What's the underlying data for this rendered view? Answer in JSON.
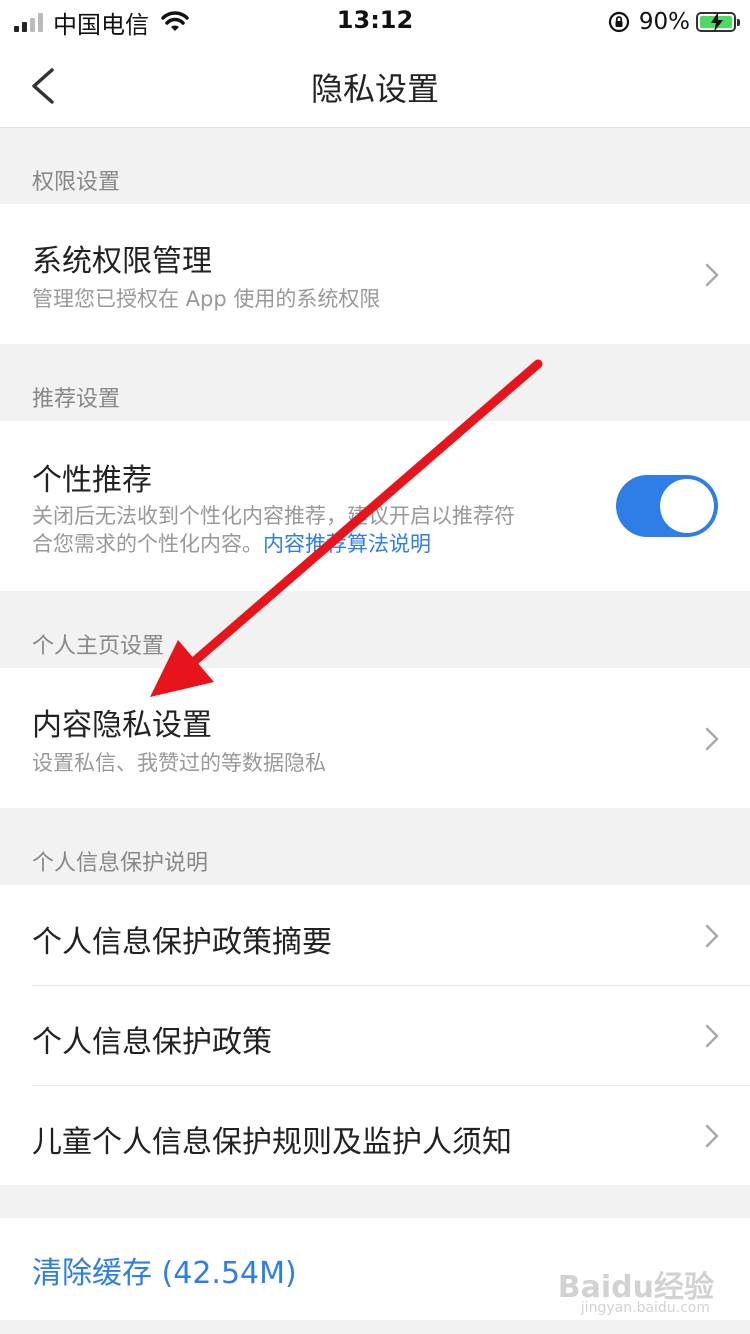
{
  "status_bar": {
    "carrier": "中国电信",
    "time": "13:12",
    "battery_percent": "90%",
    "icons": [
      "signal-icon",
      "wifi-icon",
      "orientation-lock-icon",
      "battery-charging-icon"
    ]
  },
  "nav": {
    "title": "隐私设置",
    "back_icon": "chevron-left-icon"
  },
  "sections": {
    "permissions": {
      "header": "权限设置",
      "items": [
        {
          "title": "系统权限管理",
          "subtitle": "管理您已授权在 App 使用的系统权限"
        }
      ]
    },
    "recommend": {
      "header": "推荐设置",
      "item": {
        "title": "个性推荐",
        "subtitle_line1": "关闭后无法收到个性化内容推荐，建议开启以推荐符",
        "subtitle_line2": "合您需求的个性化内容。",
        "link": "内容推荐算法说明",
        "toggle_on": true
      }
    },
    "profile": {
      "header": "个人主页设置",
      "items": [
        {
          "title": "内容隐私设置",
          "subtitle": "设置私信、我赞过的等数据隐私"
        }
      ]
    },
    "protection": {
      "header": "个人信息保护说明",
      "items": [
        {
          "title": "个人信息保护政策摘要"
        },
        {
          "title": "个人信息保护政策"
        },
        {
          "title": "儿童个人信息保护规则及监护人须知"
        }
      ]
    }
  },
  "cache": {
    "label": "清除缓存 (42.54M)"
  },
  "watermark": {
    "text": "Baidu经验",
    "sub": "jingyan.baidu.com"
  },
  "colors": {
    "accent": "#2f7ee8",
    "annotation_arrow": "#e8141b",
    "background": "#f2f2f2"
  }
}
